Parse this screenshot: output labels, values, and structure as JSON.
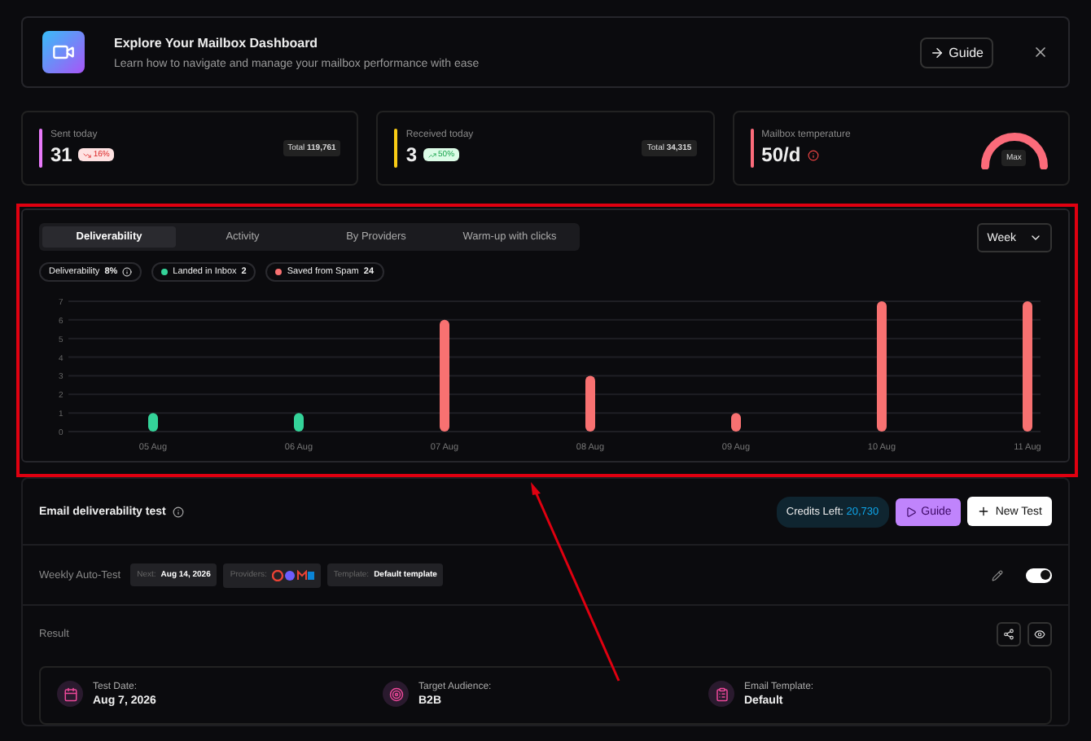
{
  "banner": {
    "title": "Explore Your Mailbox Dashboard",
    "subtitle": "Learn how to navigate and manage your mailbox performance with ease",
    "guide_button": "Guide"
  },
  "stats": [
    {
      "label": "Sent today",
      "value": "31",
      "change": "16%",
      "kind": "down",
      "total_label": "Total",
      "total": "119,761",
      "color": "#e879f9"
    },
    {
      "label": "Received today",
      "value": "3",
      "change": "50%",
      "kind": "up",
      "total_label": "Total",
      "total": "34,315",
      "color": "#facc15"
    },
    {
      "label": "Mailbox temperature",
      "value": "50/d",
      "kind": "gauge",
      "gauge_label": "Max",
      "color": "#fb6b7a"
    }
  ],
  "tabs": [
    {
      "label": "Deliverability",
      "selected": true
    },
    {
      "label": "Activity",
      "selected": false
    },
    {
      "label": "By Providers",
      "selected": false
    },
    {
      "label": "Warm-up with clicks",
      "selected": false
    }
  ],
  "period": "Week",
  "deliverability": {
    "label": "Deliverability",
    "value": "8%"
  },
  "legend_values": [
    "2",
    "24"
  ],
  "chart_data": {
    "type": "bar",
    "stacked": true,
    "grid": true,
    "categories": [
      "05 Aug",
      "06 Aug",
      "07 Aug",
      "08 Aug",
      "09 Aug",
      "10 Aug",
      "11 Aug"
    ],
    "yticks": [
      0,
      1,
      2,
      3,
      4,
      5,
      6,
      7
    ],
    "ylim": [
      0,
      7
    ],
    "series": [
      {
        "name": "Landed in Inbox",
        "color": "#34d399",
        "values": [
          1,
          1,
          0,
          0,
          0,
          0,
          0
        ]
      },
      {
        "name": "Saved from Spam",
        "color": "#f87171",
        "values": [
          0,
          0,
          6,
          3,
          1,
          7,
          7
        ]
      }
    ]
  },
  "test": {
    "title": "Email deliverability test",
    "credits_label": "Credits Left:",
    "credits": "20,730",
    "guide_button": "Guide",
    "new_button": "New Test",
    "auto_label": "Weekly Auto-Test",
    "next_label": "Next:",
    "next": "Aug 14, 2026",
    "providers_label": "Providers:",
    "template_label": "Template:",
    "template": "Default template",
    "auto_on": true,
    "result_label": "Result",
    "info": [
      {
        "label": "Test Date:",
        "value": "Aug 7, 2026",
        "kind": "calendar"
      },
      {
        "label": "Target Audience:",
        "value": "B2B",
        "kind": "target"
      },
      {
        "label": "Email Template:",
        "value": "Default",
        "kind": "clipboard"
      }
    ]
  }
}
